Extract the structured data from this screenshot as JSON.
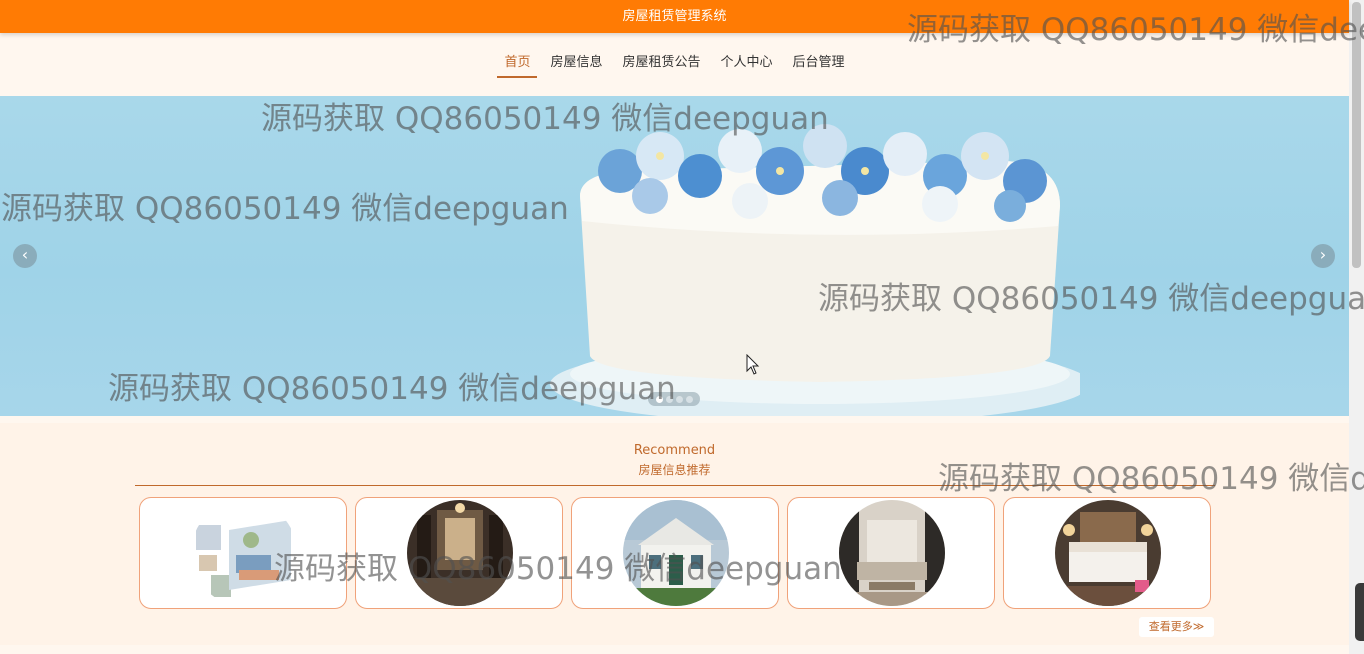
{
  "header": {
    "title": "房屋租赁管理系统"
  },
  "nav": {
    "items": [
      "首页",
      "房屋信息",
      "房屋租赁公告",
      "个人中心",
      "后台管理"
    ],
    "active_index": 0
  },
  "banner": {
    "prev_icon": "chevron-left-icon",
    "next_icon": "chevron-right-icon",
    "prev_glyph": "‹",
    "next_glyph": "›",
    "slide_count": 4,
    "active_slide": 0
  },
  "recommend": {
    "title_en": "Recommend",
    "title_cn": "房屋信息推荐",
    "more_label": "查看更多≫"
  },
  "watermark": {
    "text": "源码获取 QQ86050149 微信deepguan"
  },
  "colors": {
    "header": "#ff7b04",
    "accent": "#c0692c",
    "background": "#fff7ef"
  }
}
